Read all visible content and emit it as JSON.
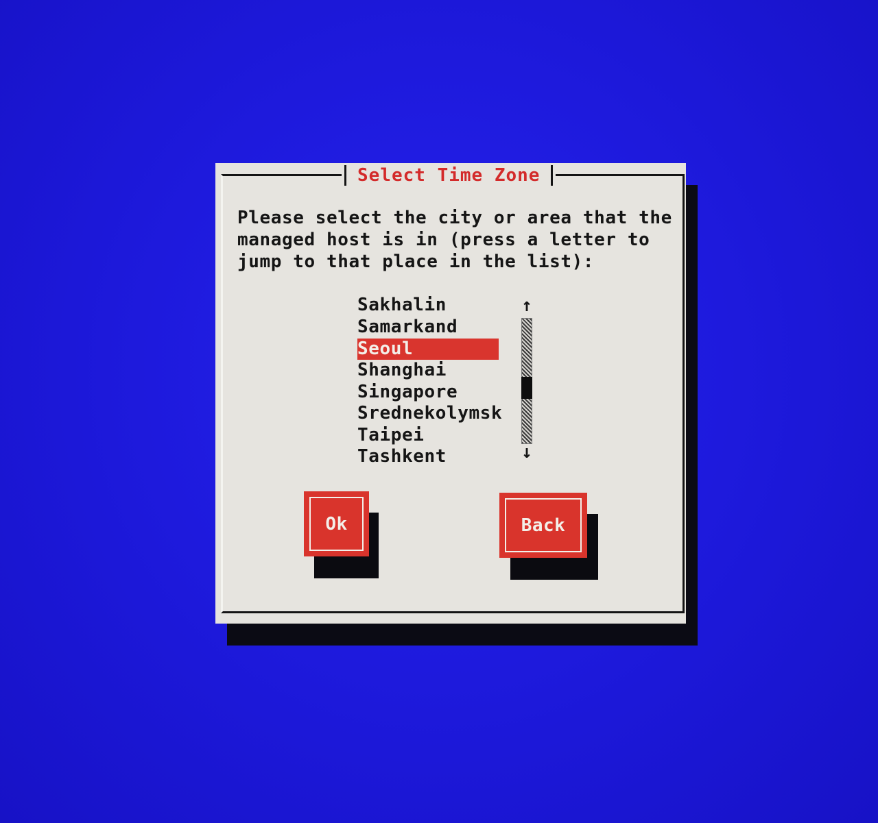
{
  "dialog": {
    "title": "Select Time Zone",
    "prompt": "Please select the city or area that the\nmanaged host is in (press a letter to\njump to that place in the list):"
  },
  "timezone_list": {
    "items": [
      {
        "label": "Sakhalin",
        "selected": false
      },
      {
        "label": "Samarkand",
        "selected": false
      },
      {
        "label": "Seoul",
        "selected": true
      },
      {
        "label": "Shanghai",
        "selected": false
      },
      {
        "label": "Singapore",
        "selected": false
      },
      {
        "label": "Srednekolymsk",
        "selected": false
      },
      {
        "label": "Taipei",
        "selected": false
      },
      {
        "label": "Tashkent",
        "selected": false
      }
    ],
    "scroll_up_glyph": "↑",
    "scroll_down_glyph": "↓",
    "scroll_position": 0.57
  },
  "buttons": {
    "ok_label": "Ok",
    "back_label": "Back"
  },
  "colors": {
    "background": "#1d1bdc",
    "dialog": "#e6e4df",
    "accent": "#d9342c",
    "shadow": "#0b0b14"
  }
}
